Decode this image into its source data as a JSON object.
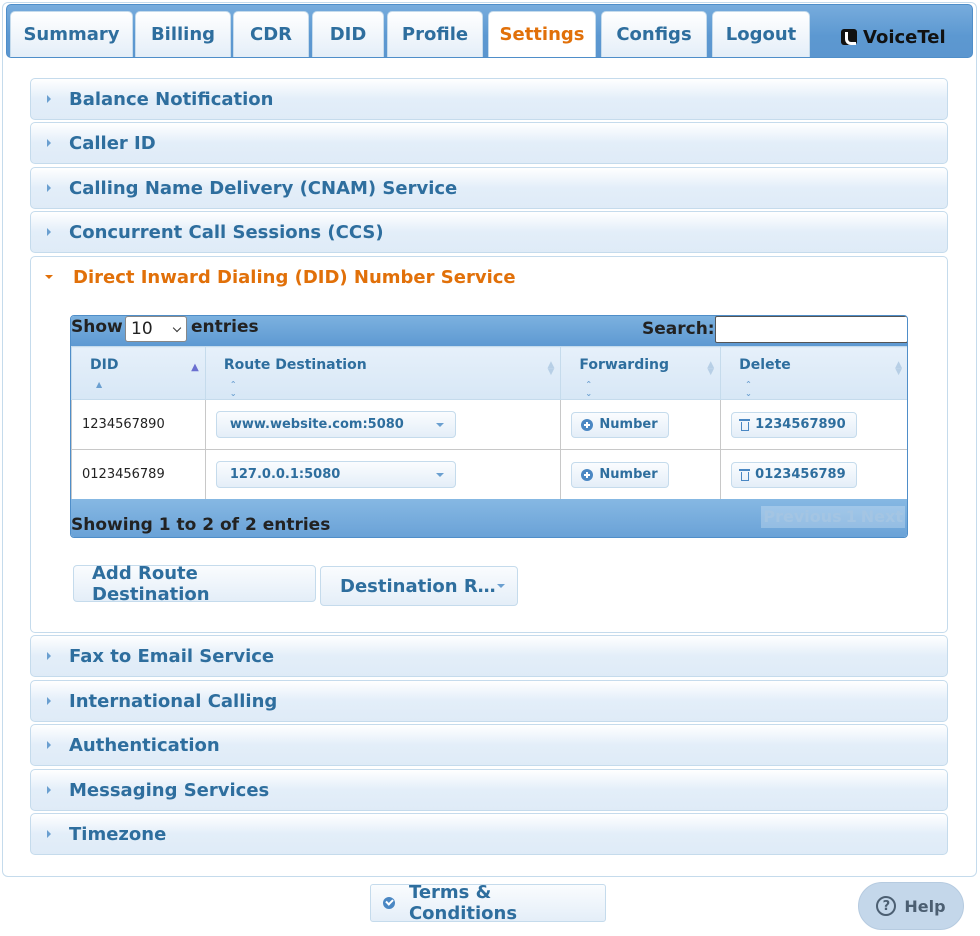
{
  "tabs": [
    {
      "label": "Summary"
    },
    {
      "label": "Billing"
    },
    {
      "label": "CDR"
    },
    {
      "label": "DID"
    },
    {
      "label": "Profile"
    },
    {
      "label": "Settings",
      "active": true
    },
    {
      "label": "Configs"
    },
    {
      "label": "Logout"
    }
  ],
  "brand": {
    "name": "VoiceTel",
    "icon": "phone-icon"
  },
  "accordion": {
    "sections": [
      {
        "title": "Balance Notification"
      },
      {
        "title": "Caller ID"
      },
      {
        "title": "Calling Name Delivery (CNAM) Service"
      },
      {
        "title": "Concurrent Call Sessions (CCS)"
      },
      {
        "title": "Direct Inward Dialing (DID) Number Service",
        "open": true
      },
      {
        "title": "Fax to Email Service"
      },
      {
        "title": "International Calling"
      },
      {
        "title": "Authentication"
      },
      {
        "title": "Messaging Services"
      },
      {
        "title": "Timezone"
      }
    ]
  },
  "did_table": {
    "show_label": "Show",
    "page_length": "10",
    "entries_label": "entries",
    "search_label": "Search:",
    "search_value": "",
    "columns": [
      "DID",
      "Route Destination",
      "Forwarding",
      "Delete"
    ],
    "rows": [
      {
        "did": "1234567890",
        "route": "www.website.com:5080",
        "forwarding": "Number",
        "delete": "1234567890"
      },
      {
        "did": "0123456789",
        "route": "127.0.0.1:5080",
        "forwarding": "Number",
        "delete": "0123456789"
      }
    ],
    "info": "Showing 1 to 2 of 2 entries",
    "pager": {
      "previous": "Previous",
      "page": "1",
      "next": "Next"
    }
  },
  "actions": {
    "add_route": "Add Route Destination",
    "destination_r": "Destination R…"
  },
  "footer": {
    "terms": "Terms & Conditions",
    "help": "Help"
  },
  "colors": {
    "accent": "#e17009",
    "primary_text": "#2e6e9e",
    "tab_bar": "#5c98d1",
    "border": "#c5dbec"
  }
}
